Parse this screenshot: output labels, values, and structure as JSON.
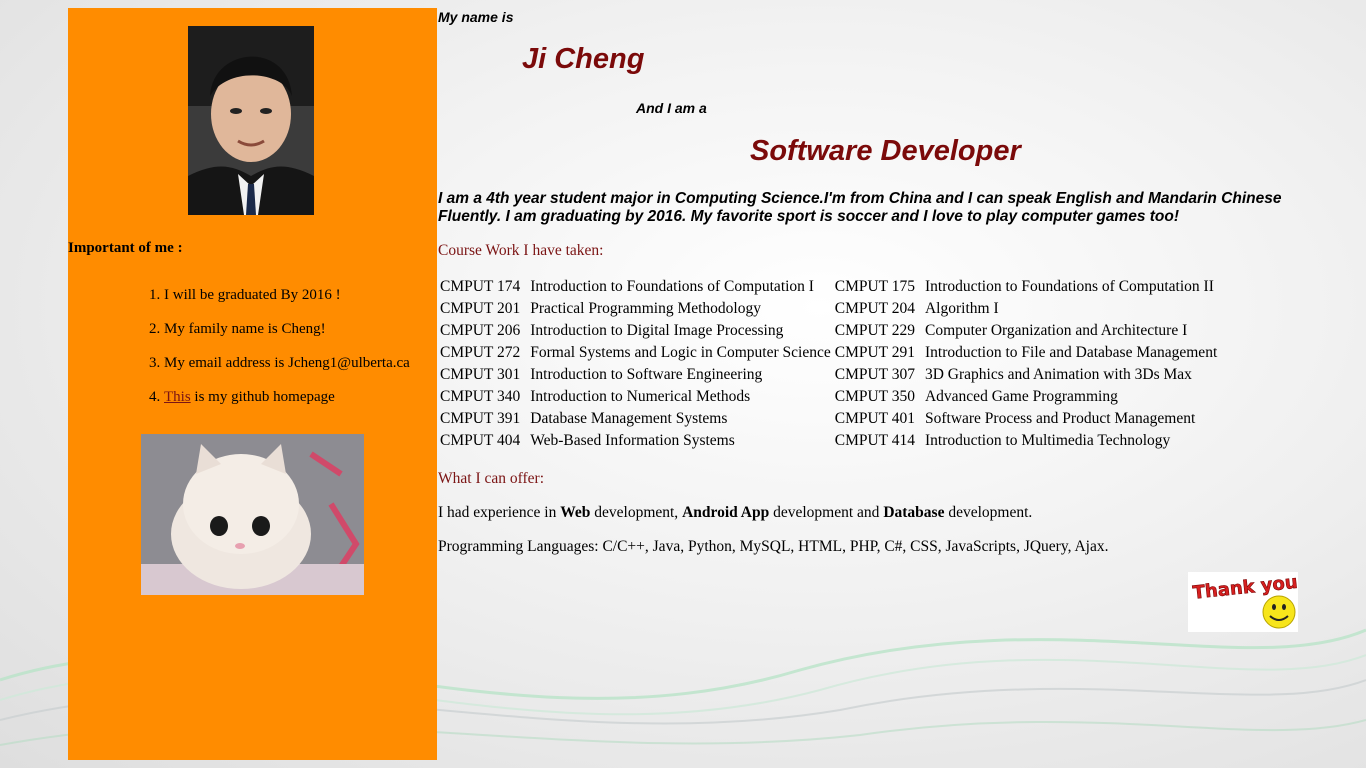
{
  "sidebar": {
    "important_heading": "Important of me :",
    "items": [
      {
        "text": "I will be graduated By 2016 !"
      },
      {
        "text": "My family name is Cheng!"
      },
      {
        "text": "My email address is Jcheng1@ulberta.ca"
      },
      {
        "link": "This",
        "text": " is my github homepage"
      }
    ]
  },
  "intro": {
    "my_name_is": "My name is",
    "name": "Ji Cheng",
    "and_i_am_a": "And I am a",
    "role": "Software Developer"
  },
  "bio": "I am a 4th year student major in Computing Science.I'm from China and I can speak English and Mandarin Chinese Fluently. I am graduating by 2016. My favorite sport is soccer and I love to play computer games too!",
  "coursework": {
    "heading": "Course Work I have taken:",
    "rows": [
      [
        {
          "code": "CMPUT 174",
          "title": "Introduction to Foundations of Computation I"
        },
        {
          "code": "CMPUT 175",
          "title": "Introduction to Foundations of Computation II"
        }
      ],
      [
        {
          "code": "CMPUT 201",
          "title": "Practical Programming Methodology"
        },
        {
          "code": "CMPUT 204",
          "title": "Algorithm I"
        }
      ],
      [
        {
          "code": "CMPUT 206",
          "title": "Introduction to Digital Image Processing"
        },
        {
          "code": "CMPUT 229",
          "title": "Computer Organization and Architecture I"
        }
      ],
      [
        {
          "code": "CMPUT 272",
          "title": "Formal Systems and Logic in Computer Science"
        },
        {
          "code": "CMPUT 291",
          "title": "Introduction to File and Database Management"
        }
      ],
      [
        {
          "code": "CMPUT 301",
          "title": "Introduction to Software Engineering"
        },
        {
          "code": "CMPUT 307",
          "title": "3D Graphics and Animation with 3Ds Max"
        }
      ],
      [
        {
          "code": "CMPUT 340",
          "title": "Introduction to Numerical Methods"
        },
        {
          "code": "CMPUT 350",
          "title": "Advanced Game Programming"
        }
      ],
      [
        {
          "code": "CMPUT 391",
          "title": "Database Management Systems"
        },
        {
          "code": "CMPUT 401",
          "title": "Software Process and Product Management"
        }
      ],
      [
        {
          "code": "CMPUT 404",
          "title": "Web-Based Information Systems"
        },
        {
          "code": "CMPUT 414",
          "title": "Introduction to Multimedia Technology"
        }
      ]
    ]
  },
  "offer": {
    "heading": "What I can offer:",
    "experience_prefix": "I had experience in ",
    "web": "Web",
    "mid1": " development, ",
    "android": "Android App",
    "mid2": " development and ",
    "database": "Database",
    "suffix": " development.",
    "languages": "Programming Languages: C/C++, Java, Python, MySQL, HTML, PHP, C#, CSS, JavaScripts, JQuery, Ajax."
  },
  "thank_you": {
    "text": "Thank you!"
  },
  "colors": {
    "sidebar_bg": "#ff8c00",
    "heading_red": "#7b0a0a"
  }
}
